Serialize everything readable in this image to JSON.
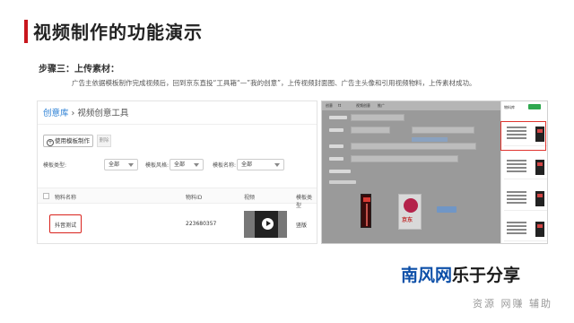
{
  "slide": {
    "title": "视频制作的功能演示",
    "step_label": "步骤三：上传素材：",
    "description": "广告主依据模板制作完成视频后，回到京东直投“工具箱“—”我的创意”，上传视频封面图、广告主头像和引用视频物料，上传素材成功。",
    "accent_color": "#c8161d"
  },
  "left_panel": {
    "breadcrumb": {
      "link": "创意库",
      "separator": "›",
      "current": "视频创意工具"
    },
    "buttons": {
      "use_template": "使用模板制作",
      "secondary": "删除"
    },
    "filters": [
      {
        "label": "模板类型:",
        "value": "全部"
      },
      {
        "label": "模板风格:",
        "value": "全部"
      },
      {
        "label": "模板名称:",
        "value": "全部"
      }
    ],
    "table": {
      "headers": [
        "物料名称",
        "物料ID",
        "视频",
        "模板类型"
      ],
      "rows": [
        {
          "name": "抖音测试",
          "id": "223680357",
          "type": "竖版"
        }
      ]
    },
    "highlight_color": "#d9231d"
  },
  "right_panel": {
    "top_items": [
      "创意",
      "tt",
      "视频创意",
      "推广"
    ],
    "phone_brand": "京东",
    "sidebar_tag": "物料库",
    "highlight_color": "#e0352f"
  },
  "watermark": {
    "brand_blue": "南风网",
    "brand_black": "乐于分享",
    "subtitle": "资源 网赚 辅助",
    "blue_color": "#0d4fa8"
  }
}
